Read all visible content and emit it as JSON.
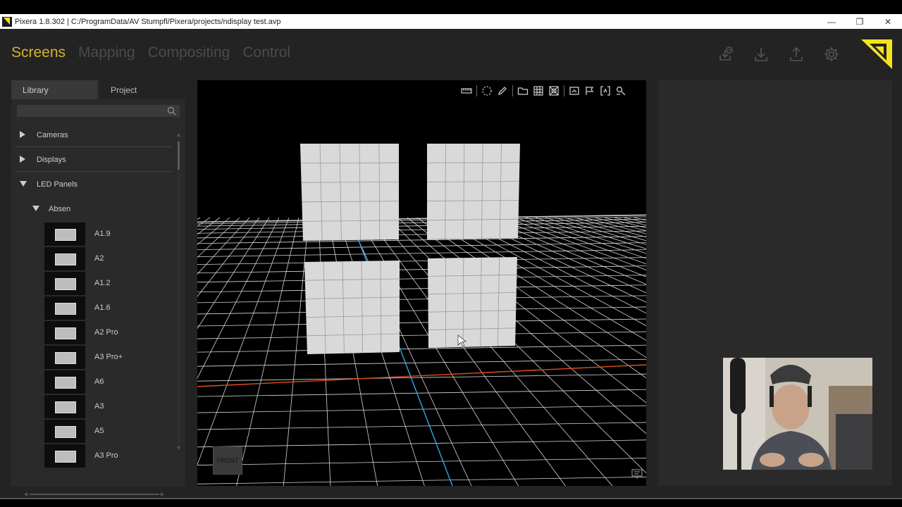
{
  "window": {
    "title": "Pixera 1.8.302 | C:/ProgramData/AV Stumpfl/Pixera/projects/ndisplay test.avp",
    "minimize": "—",
    "restore": "❐",
    "close": "✕"
  },
  "nav": {
    "tabs": [
      {
        "label": "Screens",
        "active": true
      },
      {
        "label": "Mapping",
        "active": false
      },
      {
        "label": "Compositing",
        "active": false
      },
      {
        "label": "Control",
        "active": false
      }
    ]
  },
  "top_icons": [
    "download-history-icon",
    "download-icon",
    "upload-icon",
    "gear-icon"
  ],
  "accent_color": "#d6b42b",
  "brand_color": "#f4e21a",
  "library": {
    "tabs": [
      {
        "label": "Library",
        "active": true
      },
      {
        "label": "Project",
        "active": false
      }
    ],
    "search": {
      "value": "",
      "placeholder": ""
    },
    "categories": [
      {
        "label": "Cameras",
        "expanded": false
      },
      {
        "label": "Displays",
        "expanded": false
      },
      {
        "label": "LED Panels",
        "expanded": true
      }
    ],
    "manufacturer": {
      "label": "Absen",
      "expanded": true
    },
    "panels": [
      "A1.9",
      "A2",
      "A1.2",
      "A1.6",
      "A2 Pro",
      "A3 Pro+",
      "A6",
      "A3",
      "A5",
      "A3 Pro"
    ],
    "footer_icons": [
      "add-icon",
      "trash-icon",
      "folder-icon"
    ]
  },
  "viewport": {
    "toolbar_icons": [
      "ruler-icon",
      "lasso-select-icon",
      "pencil-icon",
      "folder-view-icon",
      "grid-icon",
      "fit-view-icon",
      "snapshot-icon",
      "flag-icon",
      "frame-icon",
      "zoom-tool-icon"
    ],
    "view_cube_label": "FRONT",
    "background": "#000000",
    "grid_color": "#d8d8d8",
    "axis_x_color": "#e0501e",
    "axis_z_color": "#3aa6d8",
    "screens": 4
  }
}
